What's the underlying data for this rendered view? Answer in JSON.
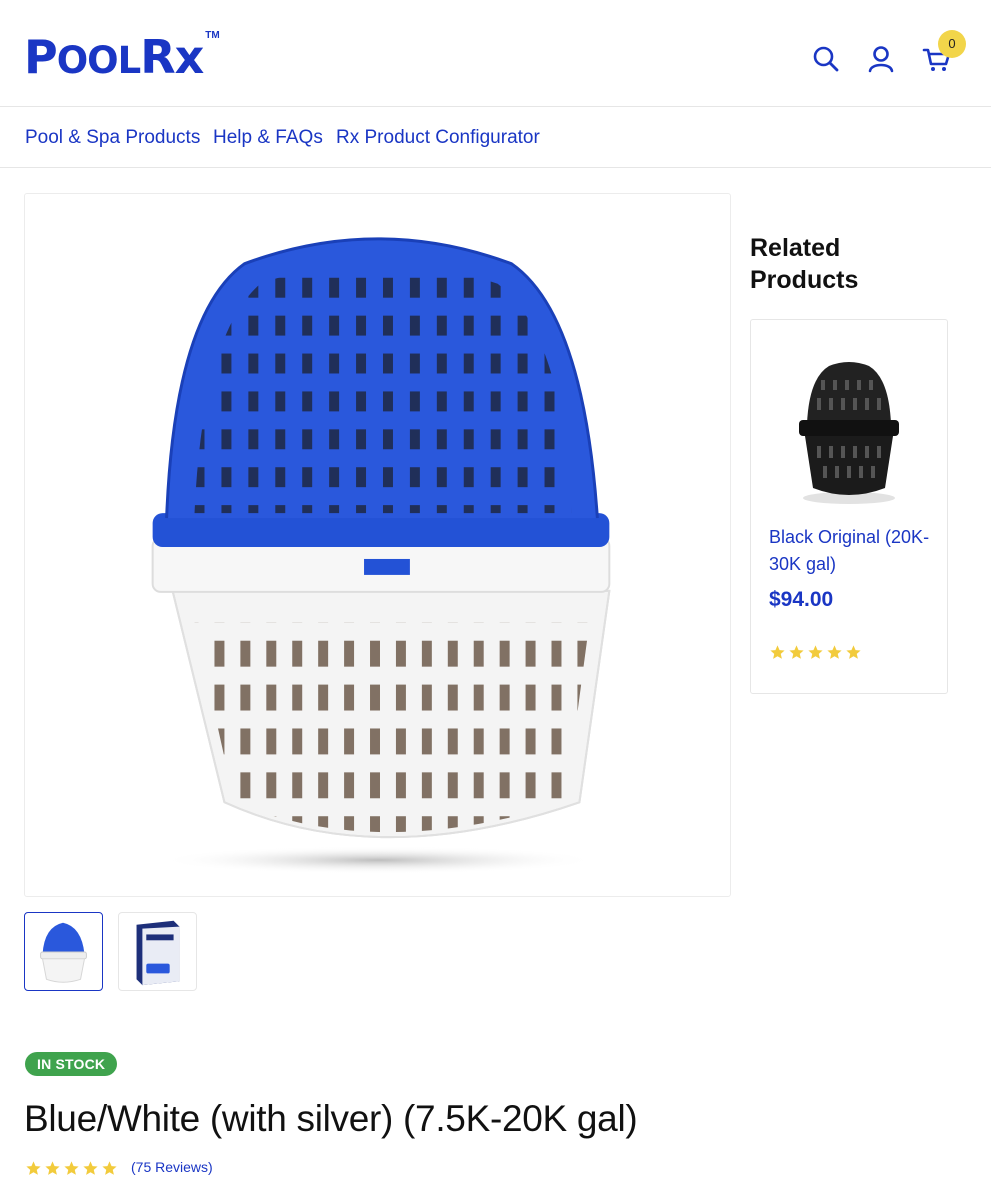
{
  "brand": {
    "logo_big_p": "P",
    "logo_small": "OOL",
    "logo_rx": "Rx",
    "trademark": "TM",
    "color": "#1a36c4"
  },
  "header": {
    "icons": [
      "search-icon",
      "user-icon",
      "cart-icon"
    ],
    "cart_count": "0",
    "badge_color": "#f2d54a"
  },
  "nav": {
    "items": [
      {
        "label": "Pool & Spa Products"
      },
      {
        "label": "Help & FAQs"
      },
      {
        "label": "Rx Product Configurator"
      }
    ]
  },
  "gallery": {
    "main_image": "blue-white-basket-image",
    "thumbnails": [
      "blue-white-basket-thumbnail",
      "product-box-thumbnail"
    ],
    "selected_index": 0
  },
  "related": {
    "title": "Related Products",
    "items": [
      {
        "name": "Black Original (20K-30K gal)",
        "price": "$94.00",
        "rating": 5
      }
    ]
  },
  "product": {
    "stock_status": "IN STOCK",
    "stock_color": "#3fa34d",
    "title": "Blue/White (with silver) (7.5K-20K gal)",
    "rating": 5,
    "reviews_label": "(75 Reviews)"
  },
  "colors": {
    "star": "#f2cb3c",
    "link": "#1a36c4"
  }
}
